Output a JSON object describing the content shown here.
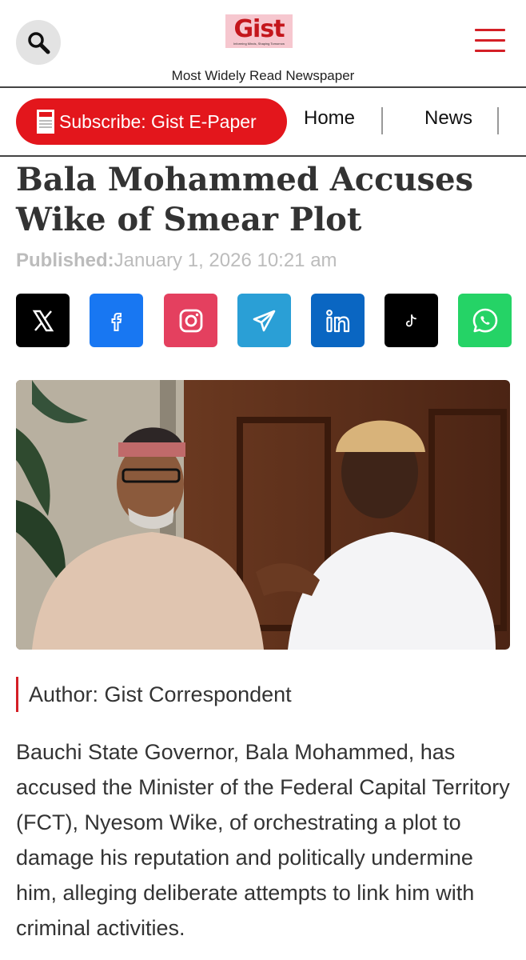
{
  "header": {
    "logo_text": "Gist",
    "logo_tagline": "Informing Minds, Shaping Tomorrow",
    "tagline": "Most Widely Read Newspaper",
    "icons": {
      "search": "search-icon",
      "menu": "hamburger-menu-icon"
    }
  },
  "nav": {
    "subscribe_label": "Subscribe: Gist E-Paper",
    "links": [
      "Home",
      "News"
    ]
  },
  "article": {
    "title": "Bala Mohammed Accuses Wike of Smear Plot",
    "published_label": "Published:",
    "published_date": "January 1, 2026 10:21 am",
    "share": [
      "x-icon",
      "facebook-icon",
      "instagram-icon",
      "telegram-icon",
      "linkedin-icon",
      "tiktok-icon",
      "whatsapp-icon"
    ],
    "author": "Author: Gist Correspondent",
    "body": "Bauchi State Governor, Bala Mohammed, has accused the Minister of the Federal Capital Territory (FCT), Nyesom Wike, of orchestrating a plot to damage his reputation and politically undermine him, alleging deliberate attempts to link him with criminal activities."
  },
  "colors": {
    "brand_red": "#e3161c",
    "facebook": "#1877f2",
    "instagram": "#e4405f",
    "telegram": "#2a9fd6",
    "linkedin": "#0a66c2",
    "tiktok": "#000000",
    "whatsapp": "#25d366",
    "x": "#000000"
  }
}
